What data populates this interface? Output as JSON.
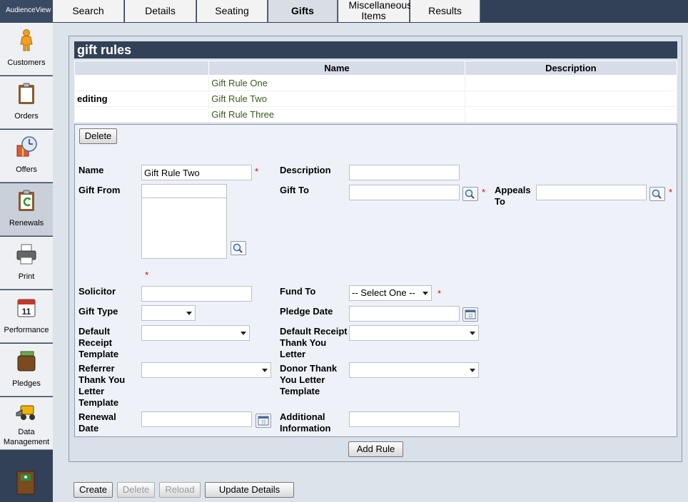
{
  "app": {
    "brand": "AudienceView"
  },
  "sidebar": {
    "items": [
      {
        "label": "Customers",
        "icon": "person-icon"
      },
      {
        "label": "Orders",
        "icon": "clipboard-icon"
      },
      {
        "label": "Offers",
        "icon": "gift-clock-icon"
      },
      {
        "label": "Renewals",
        "icon": "renewal-clipboard-icon",
        "active": true
      },
      {
        "label": "Print",
        "icon": "printer-icon"
      },
      {
        "label": "Performance",
        "icon": "calendar-icon"
      },
      {
        "label": "Pledges",
        "icon": "wallet-icon"
      },
      {
        "label": "Data\nManagement",
        "icon": "loader-icon"
      }
    ]
  },
  "tabs": [
    {
      "label": "Search"
    },
    {
      "label": "Details"
    },
    {
      "label": "Seating"
    },
    {
      "label": "Gifts",
      "active": true
    },
    {
      "label": "Miscellaneous Items"
    },
    {
      "label": "Results"
    }
  ],
  "gift_rules": {
    "title": "gift rules",
    "columns": [
      "",
      "Name",
      "Description"
    ],
    "rows": [
      {
        "state": "",
        "name": "Gift Rule One",
        "description": ""
      },
      {
        "state": "editing",
        "name": "Gift Rule Two",
        "description": ""
      },
      {
        "state": "",
        "name": "Gift Rule Three",
        "description": ""
      }
    ]
  },
  "editor": {
    "delete_label": "Delete",
    "fields": {
      "name": {
        "label": "Name",
        "value": "Gift Rule Two"
      },
      "description": {
        "label": "Description",
        "value": ""
      },
      "gift_from": {
        "label": "Gift From",
        "value": ""
      },
      "gift_to": {
        "label": "Gift To",
        "value": ""
      },
      "appeals_to": {
        "label": "Appeals To",
        "value": ""
      },
      "solicitor": {
        "label": "Solicitor",
        "value": ""
      },
      "fund_to": {
        "label": "Fund To",
        "value": "-- Select One --"
      },
      "gift_type": {
        "label": "Gift Type",
        "value": ""
      },
      "pledge_date": {
        "label": "Pledge Date",
        "value": ""
      },
      "default_receipt_template": {
        "label": "Default Receipt Template",
        "value": ""
      },
      "default_receipt_thank_you_letter": {
        "label": "Default Receipt Thank You Letter",
        "value": ""
      },
      "referrer_thank_you_letter_template": {
        "label": "Referrer Thank You Letter Template",
        "value": ""
      },
      "donor_thank_you_letter_template": {
        "label": "Donor Thank You Letter Template",
        "value": ""
      },
      "renewal_date": {
        "label": "Renewal Date",
        "value": ""
      },
      "additional_information": {
        "label": "Additional Information",
        "value": ""
      }
    },
    "required_marker": "*"
  },
  "add_rule_label": "Add Rule",
  "footer": {
    "create_label": "Create",
    "delete_label": "Delete",
    "reload_label": "Reload",
    "update_label": "Update Details"
  },
  "colors": {
    "nav_bg": "#334158",
    "panel_bg": "#d8e0ea",
    "required": "#e00000",
    "rule_name": "#3b5a1e"
  }
}
